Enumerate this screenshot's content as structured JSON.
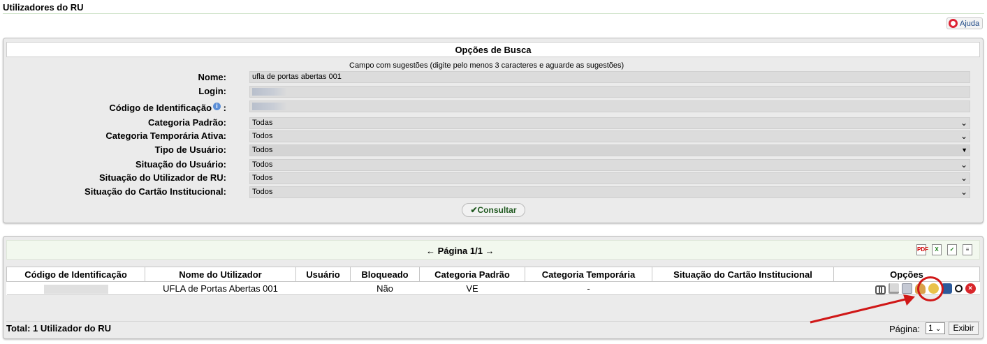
{
  "page": {
    "title": "Utilizadores do RU",
    "help_label": "Ajuda"
  },
  "search": {
    "caption": "Opções de Busca",
    "hint": "Campo com sugestões (digite pelo menos 3 caracteres e aguarde as sugestões)",
    "fields": {
      "nome": {
        "label": "Nome:",
        "value": "ufla de portas abertas 001"
      },
      "login": {
        "label": "Login:",
        "value": ""
      },
      "codigo": {
        "label": "Código de Identificação",
        "suffix": ":",
        "value": ""
      },
      "categoria_padrao": {
        "label": "Categoria Padrão:",
        "value": "Todas"
      },
      "categoria_temporaria": {
        "label": "Categoria Temporária Ativa:",
        "value": "Todos"
      },
      "tipo_usuario": {
        "label": "Tipo de Usuário:",
        "value": "Todos"
      },
      "situacao_usuario": {
        "label": "Situação do Usuário:",
        "value": "Todos"
      },
      "situacao_utilizador": {
        "label": "Situação do Utilizador de RU:",
        "value": "Todos"
      },
      "situacao_cartao": {
        "label": "Situação do Cartão Institucional:",
        "value": "Todos"
      }
    },
    "consult_label": "Consultar"
  },
  "results": {
    "pager": "← Página 1/1 →",
    "export_icons": [
      "pdf-icon",
      "excel-icon",
      "csv-icon",
      "doc-icon"
    ],
    "columns": [
      "Código de Identificação",
      "Nome do Utilizador",
      "Usuário",
      "Bloqueado",
      "Categoria Padrão",
      "Categoria Temporária",
      "Situação do Cartão Institucional",
      "Opções"
    ],
    "rows": [
      {
        "codigo": "",
        "nome": "UFLA de Portas Abertas 001",
        "usuario": "",
        "bloqueado": "Não",
        "categoria_padrao": "VE",
        "categoria_temporaria": "-",
        "situacao_cartao": ""
      }
    ],
    "total": "Total: 1 Utilizador do RU",
    "page_label": "Página:",
    "page_value": "1",
    "exibir_label": "Exibir"
  },
  "colors": {
    "highlight": "#d01717",
    "panel_bg": "#ebebeb",
    "pager_bg": "#f2f8ee"
  }
}
